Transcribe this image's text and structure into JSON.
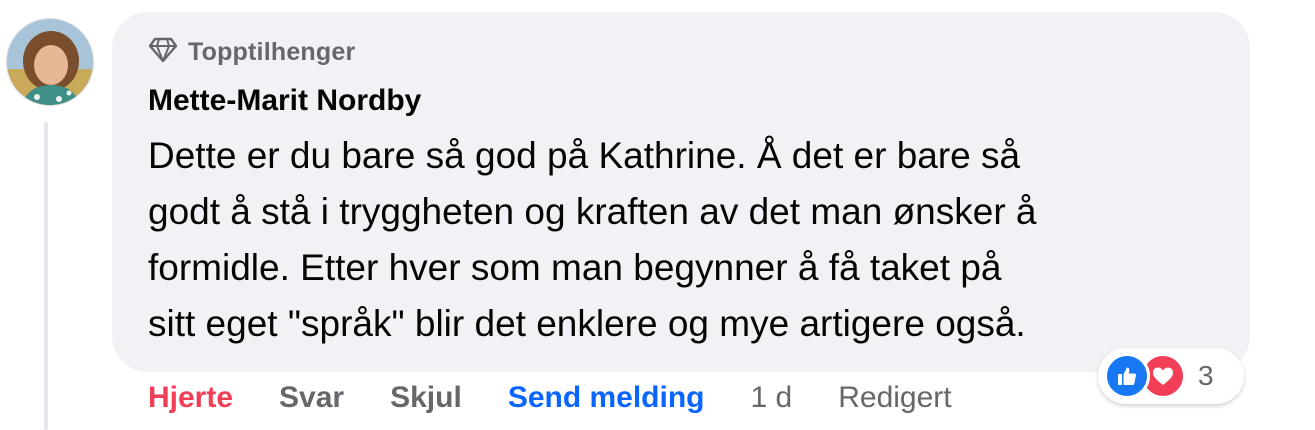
{
  "comment": {
    "badge": "Topptilhenger",
    "author": "Mette-Marit Nordby",
    "lines": [
      "Dette er du bare så god på Kathrine. Å det er bare så",
      "godt å stå i tryggheten og kraften av det man ønsker å",
      "formidle. Etter hver som man begynner å få taket på",
      "sitt eget \"språk\" blir det enklere og mye artigere også."
    ]
  },
  "actions": {
    "like": "Hjerte",
    "reply": "Svar",
    "hide": "Skjul",
    "send": "Send melding",
    "time": "1 d",
    "edited": "Redigert"
  },
  "reactions": {
    "icons": [
      "like-icon",
      "love-icon"
    ],
    "count": "3"
  },
  "colors": {
    "bubble": "#f0f2f5",
    "like_active": "#f33e58",
    "link_blue": "#0866ff",
    "muted": "#65676b"
  }
}
